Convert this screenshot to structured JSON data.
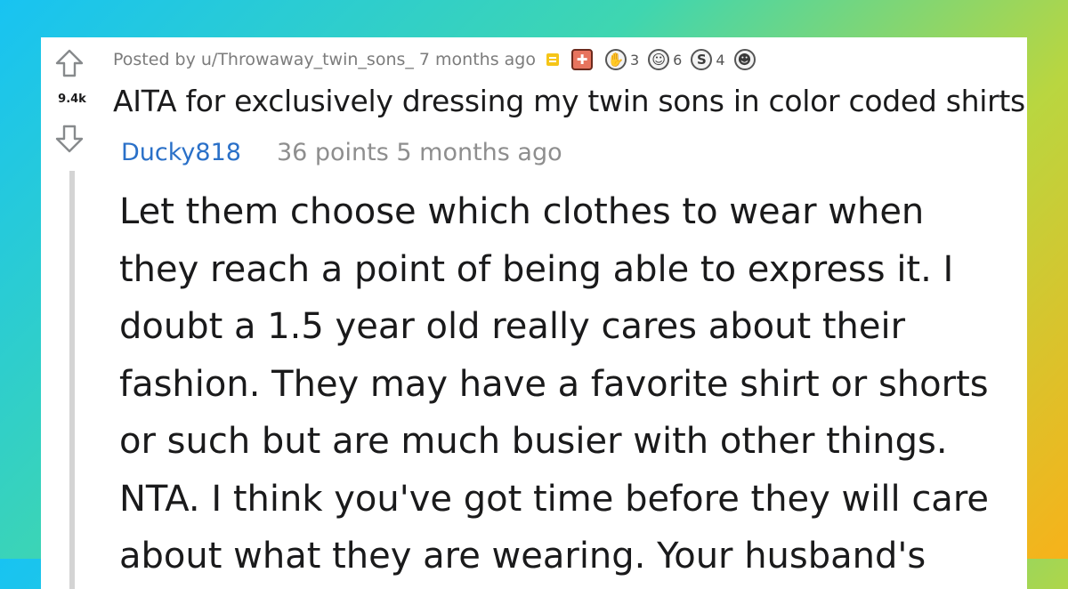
{
  "post": {
    "posted_by": "Posted by u/Throwaway_twin_sons_ 7 months ago",
    "score": "9.4k",
    "title": "AITA for exclusively dressing my twin sons in color coded shirts?",
    "awards": [
      {
        "icon": "gift-icon",
        "glyph": "",
        "count": ""
      },
      {
        "icon": "helpful-award-icon",
        "glyph": "✋",
        "count": "3"
      },
      {
        "icon": "wholesome-award-icon",
        "glyph": "☺",
        "count": "6"
      },
      {
        "icon": "silver-award-icon",
        "glyph": "S",
        "count": "4"
      },
      {
        "icon": "hugz-award-icon",
        "glyph": "☻",
        "count": ""
      }
    ]
  },
  "comment": {
    "username": "Ducky818",
    "meta": "36 points 5 months ago",
    "lines": [
      "Let them choose which clothes to wear when",
      "they reach a point of being able to express it. I",
      "doubt a 1.5 year old really cares about their",
      "fashion. They may have a favorite shirt or shorts",
      "or such but are much busier with other things.",
      "NTA. I think you've got time before they will care",
      "about what they are wearing. Your husband's"
    ]
  },
  "colors": {
    "accent_link": "#2a70c8",
    "mod_badge": "#f5c518",
    "background_gradient": [
      "#18c3f2",
      "#3fd6b0",
      "#b9d640",
      "#f7b21a"
    ]
  }
}
